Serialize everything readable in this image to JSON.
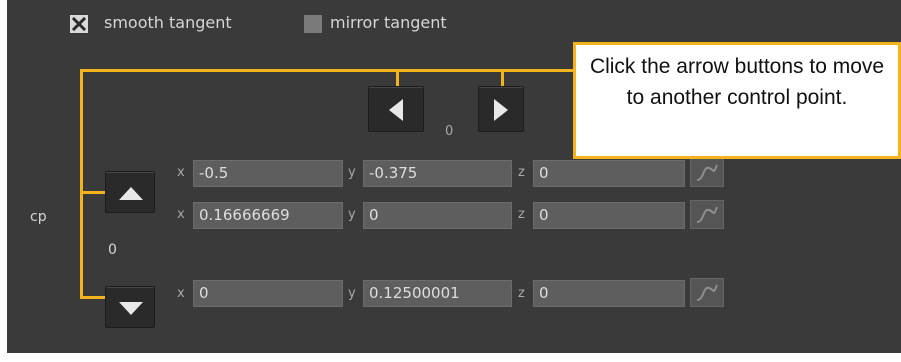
{
  "options": {
    "smooth_tangent": {
      "label": "smooth tangent",
      "checked": true
    },
    "mirror_tangent": {
      "label": "mirror tangent",
      "checked": false
    }
  },
  "control_point_nav": {
    "index": "0"
  },
  "control_point": {
    "label": "cp",
    "index": "0",
    "rows": [
      {
        "x": "-0.5",
        "y": "-0.375",
        "z": "0"
      },
      {
        "x": "0.16666669",
        "y": "0",
        "z": "0"
      },
      {
        "x": "0",
        "y": "0.12500001",
        "z": "0"
      }
    ]
  },
  "axis_labels": {
    "x": "x",
    "y": "y",
    "z": "z"
  },
  "callout": {
    "text": "Click the arrow buttons to move to another control point."
  },
  "colors": {
    "panel": "#3a3a3a",
    "field": "#5e5e5e",
    "callout_border": "#f2b31c"
  }
}
